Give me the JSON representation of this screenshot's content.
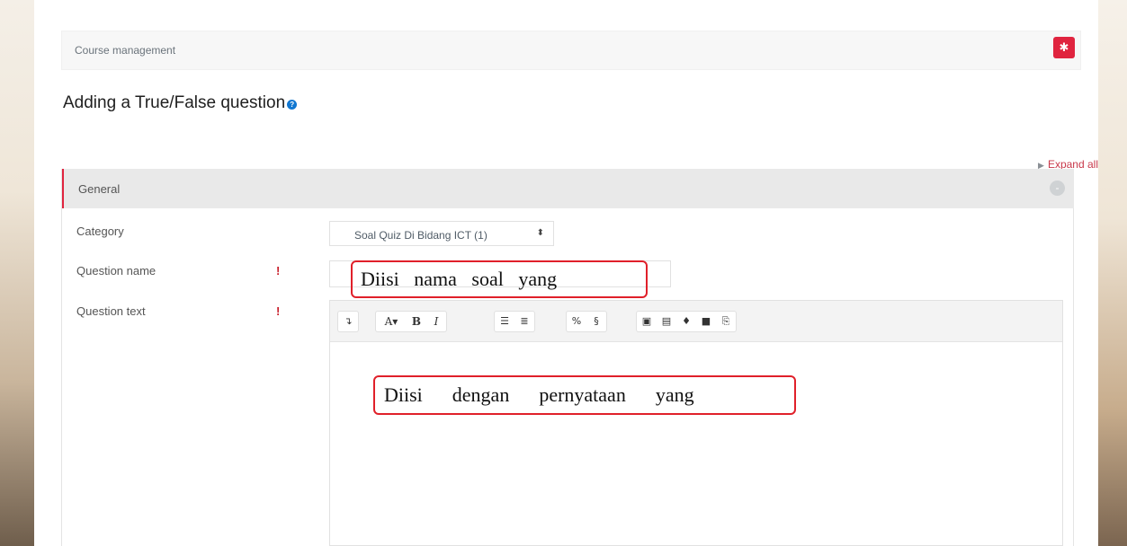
{
  "breadcrumb": {
    "label": "Course management"
  },
  "page": {
    "title": "Adding a True/False question",
    "expand_all": "Expand all"
  },
  "section": {
    "header": "General"
  },
  "form": {
    "category_label": "Category",
    "category_value": "Soal Quiz Di Bidang ICT (1)",
    "question_name_label": "Question name",
    "question_text_label": "Question text"
  },
  "toolbar": {
    "buttons": [
      "format-toggle",
      "font-color",
      "bold",
      "italic",
      "unordered-list",
      "ordered-list",
      "link",
      "unlink",
      "image",
      "media",
      "record-audio",
      "record-video",
      "manage-files"
    ],
    "bold_label": "B",
    "italic_label": "I"
  },
  "annotations": {
    "name_hint": "Diisi   nama   soal   yang",
    "text_hint": "Diisi      dengan      pernyataan      yang"
  },
  "colors": {
    "accent": "#e0243f",
    "link": "#c8384a",
    "annotation_border": "#e0202a"
  }
}
